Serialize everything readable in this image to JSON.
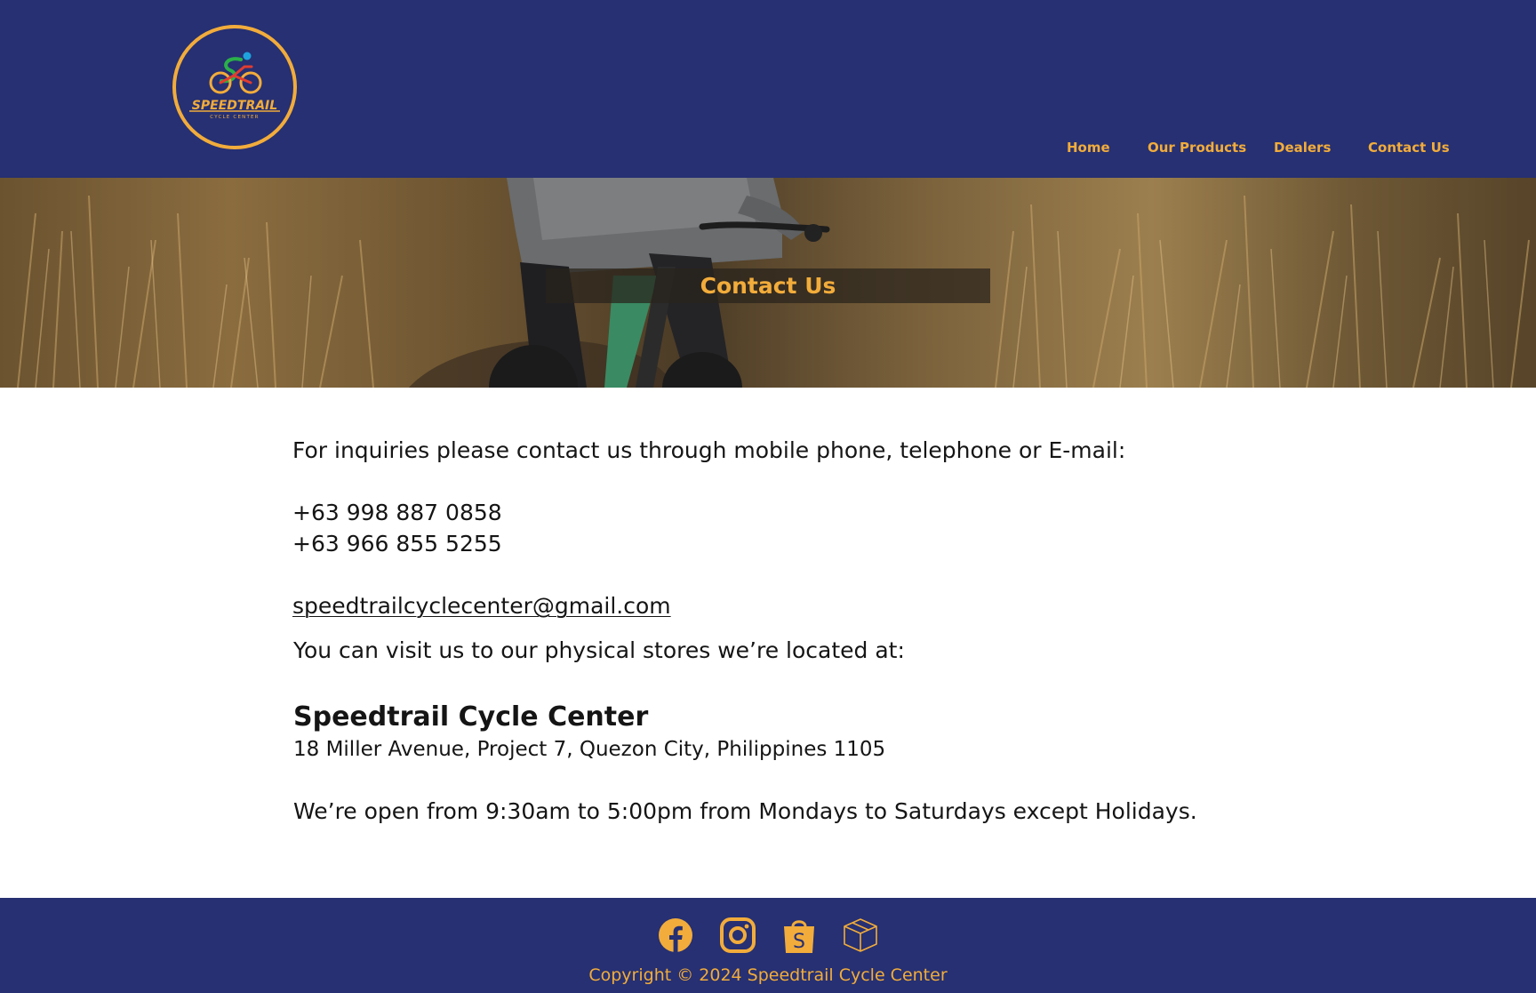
{
  "brand": {
    "logo_alt": "Speedtrail Cycle Center logo",
    "logo_text": "SPEEDTRAIL",
    "logo_subtext": "CYCLE CENTER",
    "accent_color": "#f2ac3b",
    "header_color": "#263072"
  },
  "nav": {
    "items": [
      {
        "label": "Home"
      },
      {
        "label": "Our Products"
      },
      {
        "label": "Dealers"
      },
      {
        "label": "Contact Us"
      }
    ]
  },
  "hero": {
    "title": "Contact Us"
  },
  "contact": {
    "intro": "For inquiries please contact us through mobile phone, telephone or E-mail:",
    "phones": [
      "+63 998 887 0858",
      "+63 966 855 5255"
    ],
    "email": "speedtrailcyclecenter@gmail.com",
    "visit_text": "You can visit us to our physical stores we’re located at:",
    "store_name": "Speedtrail Cycle Center",
    "address": "18 Miller Avenue, Project 7, Quezon City, Philippines 1105",
    "hours": "We’re open from 9:30am to 5:00pm from Mondays to Saturdays except Holidays."
  },
  "footer": {
    "social_icons": [
      "facebook-icon",
      "instagram-icon",
      "shopee-icon",
      "package-icon"
    ],
    "copyright": "Copyright © 2024 Speedtrail Cycle Center"
  }
}
